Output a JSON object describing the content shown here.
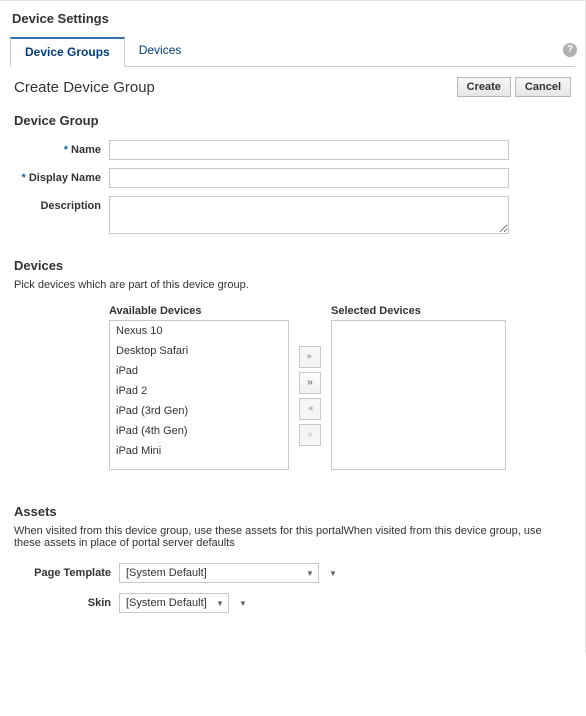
{
  "page_title": "Device Settings",
  "tabs": [
    {
      "label": "Device Groups",
      "active": true
    },
    {
      "label": "Devices",
      "active": false
    }
  ],
  "form": {
    "title": "Create Device Group",
    "buttons": {
      "create": "Create",
      "cancel": "Cancel"
    },
    "device_group": {
      "legend": "Device Group",
      "name_label": "Name",
      "display_name_label": "Display Name",
      "description_label": "Description",
      "name_value": "",
      "display_name_value": "",
      "description_value": ""
    },
    "devices": {
      "legend": "Devices",
      "hint": "Pick devices which are part of this device group.",
      "available_label": "Available Devices",
      "selected_label": "Selected Devices",
      "available": [
        "Nexus 10",
        "Desktop Safari",
        "iPad",
        "iPad 2",
        "iPad (3rd Gen)",
        "iPad (4th Gen)",
        "iPad Mini"
      ],
      "selected": []
    },
    "assets": {
      "legend": "Assets",
      "hint": "When visited from this device group, use these assets for this portalWhen visited from this device group, use these assets in place of portal server defaults",
      "page_template_label": "Page Template",
      "page_template_value": "[System Default]",
      "skin_label": "Skin",
      "skin_value": "[System Default]"
    }
  }
}
